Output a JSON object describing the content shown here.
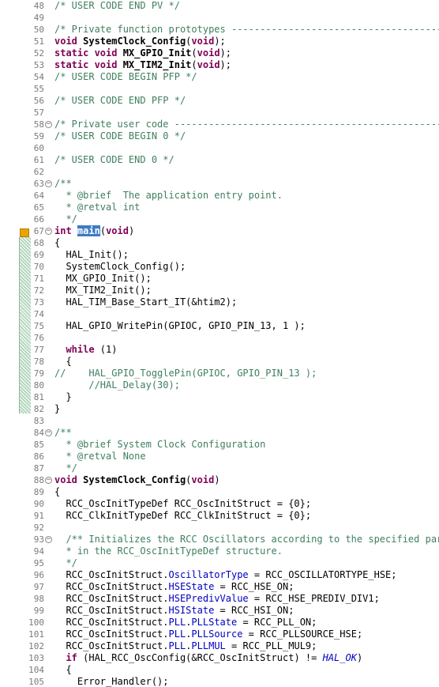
{
  "editor": {
    "lines": [
      {
        "n": "48",
        "t": "/* USER CODE END PV */",
        "k": "cm"
      },
      {
        "n": "49",
        "t": ""
      },
      {
        "n": "50",
        "t": "/* Private function prototypes -----------------------------------------------",
        "k": "cm"
      },
      {
        "n": "51",
        "t": "void SystemClock_Config(void);",
        "k": "decl"
      },
      {
        "n": "52",
        "t": "static void MX_GPIO_Init(void);",
        "k": "decl"
      },
      {
        "n": "53",
        "t": "static void MX_TIM2_Init(void);",
        "k": "decl"
      },
      {
        "n": "54",
        "t": "/* USER CODE BEGIN PFP */",
        "k": "cm"
      },
      {
        "n": "55",
        "t": ""
      },
      {
        "n": "56",
        "t": "/* USER CODE END PFP */",
        "k": "cm"
      },
      {
        "n": "57",
        "t": ""
      },
      {
        "n": "58",
        "t": "/* Private user code ---------------------------------------------------------",
        "k": "cm",
        "fold": true
      },
      {
        "n": "59",
        "t": "/* USER CODE BEGIN 0 */",
        "k": "cm"
      },
      {
        "n": "60",
        "t": ""
      },
      {
        "n": "61",
        "t": "/* USER CODE END 0 */",
        "k": "cm"
      },
      {
        "n": "62",
        "t": ""
      },
      {
        "n": "63",
        "t": "/**",
        "k": "cm",
        "fold": true
      },
      {
        "n": "64",
        "t": "  * @brief  The application entry point.",
        "k": "cm"
      },
      {
        "n": "65",
        "t": "  * @retval int",
        "k": "cm"
      },
      {
        "n": "66",
        "t": "  */",
        "k": "cm"
      },
      {
        "n": "67",
        "t": "int main(void)",
        "k": "main",
        "fold": true
      },
      {
        "n": "68",
        "t": "{"
      },
      {
        "n": "69",
        "t": "  HAL_Init();"
      },
      {
        "n": "70",
        "t": "  SystemClock_Config();"
      },
      {
        "n": "71",
        "t": "  MX_GPIO_Init();"
      },
      {
        "n": "72",
        "t": "  MX_TIM2_Init();"
      },
      {
        "n": "73",
        "t": "  HAL_TIM_Base_Start_IT(&htim2);"
      },
      {
        "n": "74",
        "t": ""
      },
      {
        "n": "75",
        "t": "  HAL_GPIO_WritePin(GPIOC, GPIO_PIN_13, 1 );"
      },
      {
        "n": "76",
        "t": ""
      },
      {
        "n": "77",
        "t": "  while (1)",
        "k": "while"
      },
      {
        "n": "78",
        "t": "  {"
      },
      {
        "n": "79",
        "t": "//    HAL_GPIO_TogglePin(GPIOC, GPIO_PIN_13 );",
        "k": "cm"
      },
      {
        "n": "80",
        "t": "      //HAL_Delay(30);",
        "k": "cm"
      },
      {
        "n": "81",
        "t": "  }"
      },
      {
        "n": "82",
        "t": "}"
      },
      {
        "n": "83",
        "t": ""
      },
      {
        "n": "84",
        "t": "/**",
        "k": "cm",
        "fold": true
      },
      {
        "n": "85",
        "t": "  * @brief System Clock Configuration",
        "k": "cm"
      },
      {
        "n": "86",
        "t": "  * @retval None",
        "k": "cm"
      },
      {
        "n": "87",
        "t": "  */",
        "k": "cm"
      },
      {
        "n": "88",
        "t": "void SystemClock_Config(void)",
        "k": "decl",
        "fold": true
      },
      {
        "n": "89",
        "t": "{"
      },
      {
        "n": "90",
        "t": "  RCC_OscInitTypeDef RCC_OscInitStruct = {0};"
      },
      {
        "n": "91",
        "t": "  RCC_ClkInitTypeDef RCC_ClkInitStruct = {0};"
      },
      {
        "n": "92",
        "t": ""
      },
      {
        "n": "93",
        "t": "  /** Initializes the RCC Oscillators according to the specified parameters",
        "k": "cm",
        "fold": true
      },
      {
        "n": "94",
        "t": "  * in the RCC_OscInitTypeDef structure.",
        "k": "cm"
      },
      {
        "n": "95",
        "t": "  */",
        "k": "cm"
      },
      {
        "n": "96",
        "t": "  RCC_OscInitStruct.OscillatorType = RCC_OSCILLATORTYPE_HSE;",
        "k": "fld"
      },
      {
        "n": "97",
        "t": "  RCC_OscInitStruct.HSEState = RCC_HSE_ON;",
        "k": "fld"
      },
      {
        "n": "98",
        "t": "  RCC_OscInitStruct.HSEPredivValue = RCC_HSE_PREDIV_DIV1;",
        "k": "fld"
      },
      {
        "n": "99",
        "t": "  RCC_OscInitStruct.HSIState = RCC_HSI_ON;",
        "k": "fld"
      },
      {
        "n": "100",
        "t": "  RCC_OscInitStruct.PLL.PLLState = RCC_PLL_ON;",
        "k": "fld"
      },
      {
        "n": "101",
        "t": "  RCC_OscInitStruct.PLL.PLLSource = RCC_PLLSOURCE_HSE;",
        "k": "fld"
      },
      {
        "n": "102",
        "t": "  RCC_OscInitStruct.PLL.PLLMUL = RCC_PLL_MUL9;",
        "k": "fld"
      },
      {
        "n": "103",
        "t": "  if (HAL_RCC_OscConfig(&RCC_OscInitStruct) != HAL_OK)",
        "k": "if"
      },
      {
        "n": "104",
        "t": "  {"
      },
      {
        "n": "105",
        "t": "    Error_Handler();"
      }
    ]
  }
}
